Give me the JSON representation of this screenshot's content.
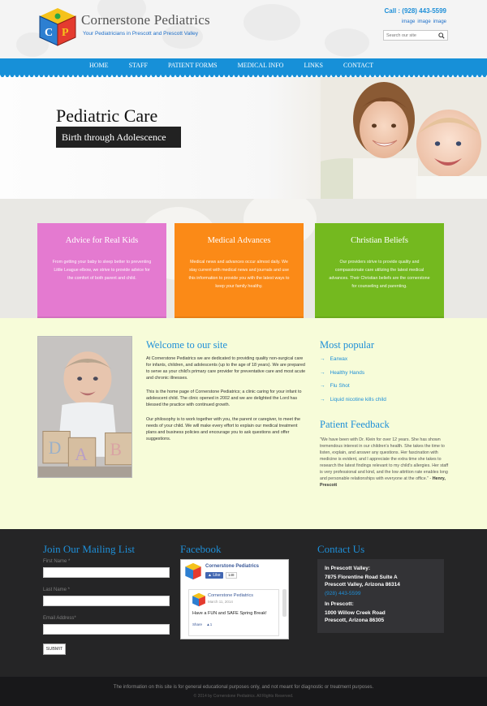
{
  "header": {
    "site_name": "Cornerstone Pediatrics",
    "tagline": "Your Pediatricians in Prescott and Prescott Valley",
    "call": "Call : (928) 443-5599",
    "social": [
      "image",
      "image",
      "image"
    ],
    "search_placeholder": "Search our site"
  },
  "nav": {
    "items": [
      "HOME",
      "STAFF",
      "PATIENT FORMS",
      "MEDICAL INFO",
      "LINKS",
      "CONTACT"
    ]
  },
  "hero": {
    "title": "Pediatric Care",
    "subtitle": "Birth through Adolescence"
  },
  "cards": [
    {
      "title": "Advice for Real Kids",
      "text": "From getting your baby to sleep better to preventing Little League elbow, we strive to provide advice for the comfort of both parent and child.",
      "color": "#e47ad0"
    },
    {
      "title": "Medical Advances",
      "text": "Medical news and advances occur almost daily. We stay current with medical news and journals and use this information to provide you with the latest ways to keep your family healthy.",
      "color": "#fb8a17"
    },
    {
      "title": "Christian Beliefs",
      "text": "Our providers strive to provide quality and compassionate care utilizing the latest medical advances. Their Christian beliefs are the cornerstone for counseling and parenting.",
      "color": "#74b91f"
    }
  ],
  "welcome": {
    "title": "Welcome to our site",
    "p1": "At Cornerstone Pediatrics we are dedicated to providing quality non-surgical care for infants, children, and adolescents (up to the age of 18 years). We are prepared to serve as your child's primary care provider for preventative care and most acute and chronic illnesses.",
    "p2": "This is the home page of Cornerstone Pediatrics; a clinic caring for your infant to adolescent child. The clinic opened in 2002 and we are delighted the Lord has blessed the practice with continued growth.",
    "p3": "Our philosophy is to work together with you, the parent or caregiver, to meet the needs of your child. We will make every effort to explain our medical treatment plans and business policies and encourage you to ask questions and offer suggestions."
  },
  "popular": {
    "title": "Most popular",
    "items": [
      "Earwax",
      "Healthy Hands",
      "Flu Shot",
      "Liquid nicotine kills child"
    ]
  },
  "feedback": {
    "title": "Patient Feedback",
    "quote": "\"We have been with Dr. Klein for over 12 years. She has shown tremendous interest in our children's health. She takes the time to listen, explain, and answer any questions. Her fascination with medicine is evident, and I appreciate the extra time she takes to research the latest findings relevant to my child's allergies. Her staff is very professional and kind, and the low attrition rate enables long and personable relationships with everyone at the office.\" -",
    "author": "Henry, Prescott"
  },
  "mailing": {
    "title": "Join Our Mailing List",
    "first_name": "First Name *",
    "last_name": "Last Name *",
    "email": "Email Address*",
    "submit": "SUBMIT"
  },
  "facebook": {
    "title": "Facebook",
    "page_name": "Cornerstone Pediatrics",
    "like_label": "Like",
    "like_count": "148",
    "post_author": "Cornerstone Pediatrics",
    "post_date": "March 11, 2014",
    "post_text": "Have a FUN and SAFE Spring Break!",
    "share_label": "Share",
    "post_likes": "1"
  },
  "contact": {
    "title": "Contact Us",
    "loc1_label": "In Prescott Valley:",
    "loc1_line1": "7875 Florentine Road Suite A",
    "loc1_line2": "Prescott Valley, Arizona 86314",
    "loc1_phone": "(928) 443-5599",
    "loc2_label": "In Prescott:",
    "loc2_line1": "1000 Willow Creek Road",
    "loc2_line2": "Prescott, Arizona 86305"
  },
  "footer": {
    "disclaimer": "The information on this site is for general educational purposes only, and not meant for diagnostic or treatment purposes.",
    "copyright": "© 2014 by Cornerstone Pediatrics. All Rights Reserved."
  }
}
